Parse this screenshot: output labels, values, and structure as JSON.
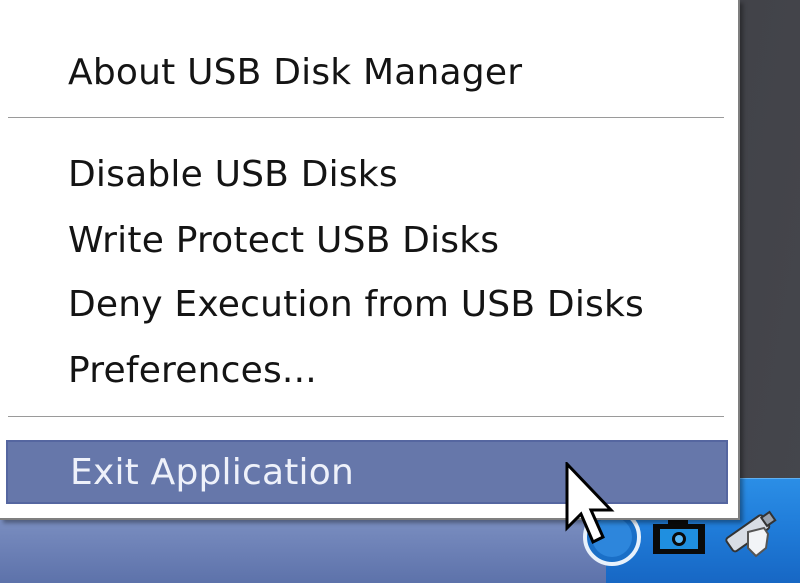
{
  "context_menu": {
    "about": "About USB Disk Manager",
    "disable": "Disable USB Disks",
    "write_protect": "Write Protect USB Disks",
    "deny_execution": "Deny Execution from USB Disks",
    "preferences": "Preferences...",
    "exit": "Exit Application",
    "selected_item": "Exit Application",
    "highlight_color": "#6677aa"
  },
  "system_tray": {
    "icons": [
      "info-icon",
      "camera-icon",
      "usb-drive-shield-icon"
    ],
    "tray_color": "#1f7bd8"
  }
}
